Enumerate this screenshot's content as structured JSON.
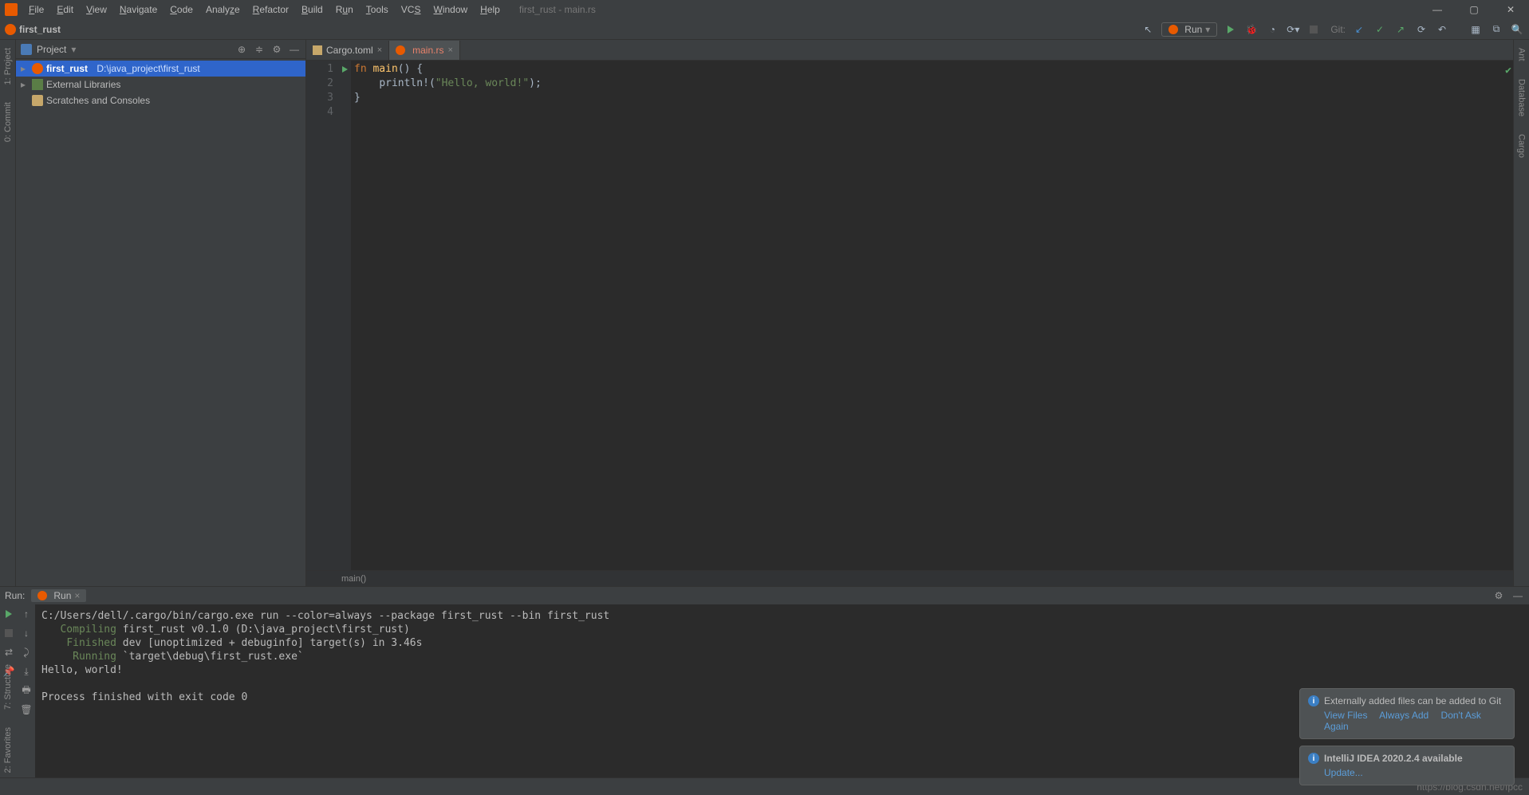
{
  "title_path": "first_rust - main.rs",
  "menus": [
    "File",
    "Edit",
    "View",
    "Navigate",
    "Code",
    "Analyze",
    "Refactor",
    "Build",
    "Run",
    "Tools",
    "VCS",
    "Window",
    "Help"
  ],
  "breadcrumb": "first_rust",
  "run_config_label": "Run",
  "git_label": "Git:",
  "project": {
    "pane_title": "Project",
    "root_name": "first_rust",
    "root_path": "D:\\java_project\\first_rust",
    "ext_lib": "External Libraries",
    "scratches": "Scratches and Consoles"
  },
  "tabs": [
    {
      "label": "Cargo.toml",
      "active": false
    },
    {
      "label": "main.rs",
      "active": true
    }
  ],
  "code": {
    "lines": [
      "fn main() {",
      "    println!(\"Hello, world!\");",
      "}",
      ""
    ]
  },
  "editor_breadcrumb": "main()",
  "run": {
    "title": "Run:",
    "tab": "Run",
    "output": "C:/Users/dell/.cargo/bin/cargo.exe run --color=always --package first_rust --bin first_rust\n   Compiling first_rust v0.1.0 (D:\\java_project\\first_rust)\n    Finished dev [unoptimized + debuginfo] target(s) in 3.46s\n     Running `target\\debug\\first_rust.exe`\nHello, world!\n\nProcess finished with exit code 0"
  },
  "side_labels": {
    "project": "1: Project",
    "commit": "0: Commit",
    "structure": "7: Structure",
    "favorites": "2: Favorites",
    "ant": "Ant",
    "database": "Database",
    "cargo": "Cargo"
  },
  "notifications": {
    "n1_title": "Externally added files can be added to Git",
    "n1_links": [
      "View Files",
      "Always Add",
      "Don't Ask Again"
    ],
    "n2_title": "IntelliJ IDEA 2020.2.4 available",
    "n2_links": [
      "Update..."
    ]
  },
  "watermark": "https://blog.csdn.net/fpcc"
}
